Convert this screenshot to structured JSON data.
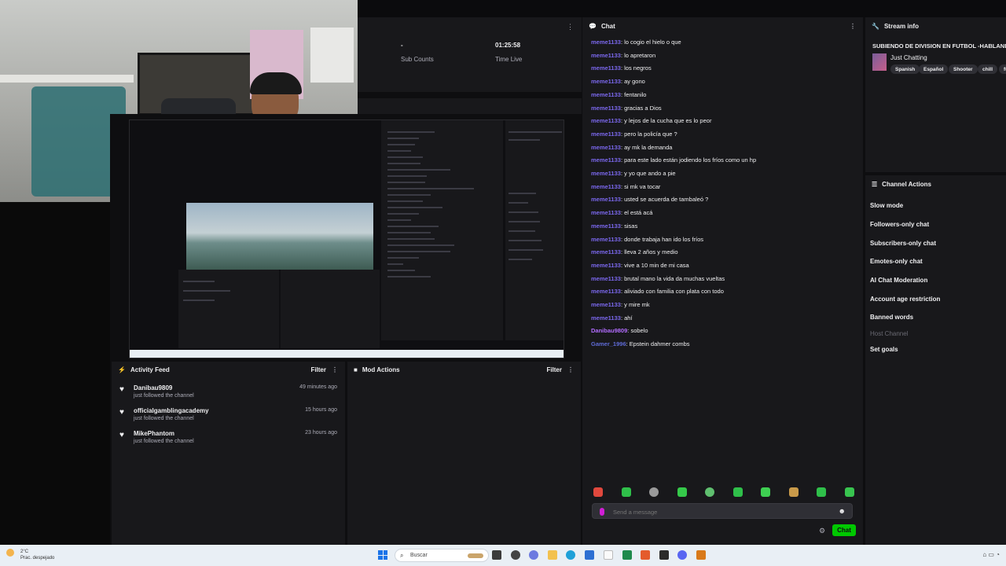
{
  "dashboard": {
    "stats": [
      {
        "value": "-",
        "label": "Sub Counts"
      },
      {
        "value": "01:25:58",
        "label": "Time Live"
      }
    ]
  },
  "activity_feed": {
    "title": "Activity Feed",
    "filter_label": "Filter",
    "items": [
      {
        "name": "Danibau9809",
        "action": "just followed the channel",
        "time": "49 minutes ago"
      },
      {
        "name": "officialgamblingacademy",
        "action": "just followed the channel",
        "time": "15 hours ago"
      },
      {
        "name": "MikePhantom",
        "action": "just followed the channel",
        "time": "23 hours ago"
      }
    ]
  },
  "mod_actions": {
    "title": "Mod Actions",
    "filter_label": "Filter"
  },
  "chat": {
    "title": "Chat",
    "messages": [
      {
        "user": "meme1133",
        "text": "lo cogio el hielo o que",
        "color": "#7b68ee"
      },
      {
        "user": "meme1133",
        "text": "lo apretaron",
        "color": "#7b68ee"
      },
      {
        "user": "meme1133",
        "text": "los negros",
        "color": "#7b68ee"
      },
      {
        "user": "meme1133",
        "text": "ay gono",
        "color": "#7b68ee"
      },
      {
        "user": "meme1133",
        "text": "fentanilo",
        "color": "#7b68ee"
      },
      {
        "user": "meme1133",
        "text": "gracias a Dios",
        "color": "#7b68ee"
      },
      {
        "user": "meme1133",
        "text": "y lejos de la cucha que es lo peor",
        "color": "#7b68ee"
      },
      {
        "user": "meme1133",
        "text": "pero la policía que ?",
        "color": "#7b68ee"
      },
      {
        "user": "meme1133",
        "text": "ay mk la demanda",
        "color": "#7b68ee"
      },
      {
        "user": "meme1133",
        "text": "para este lado están jodiendo los fríos como un hp",
        "color": "#7b68ee"
      },
      {
        "user": "meme1133",
        "text": "y yo que ando a pie",
        "color": "#7b68ee"
      },
      {
        "user": "meme1133",
        "text": "si mk va tocar",
        "color": "#7b68ee"
      },
      {
        "user": "meme1133",
        "text": "usted se acuerda de tambaleó ?",
        "color": "#7b68ee"
      },
      {
        "user": "meme1133",
        "text": "el está acá",
        "color": "#7b68ee"
      },
      {
        "user": "meme1133",
        "text": "sisas",
        "color": "#7b68ee"
      },
      {
        "user": "meme1133",
        "text": "donde trabaja han ido los fríos",
        "color": "#7b68ee"
      },
      {
        "user": "meme1133",
        "text": "lleva 2 años y medio",
        "color": "#7b68ee"
      },
      {
        "user": "meme1133",
        "text": "vive a 10 min de mi casa",
        "color": "#7b68ee"
      },
      {
        "user": "meme1133",
        "text": "brutal mano la vida da muchas vueltas",
        "color": "#7b68ee"
      },
      {
        "user": "meme1133",
        "text": "aliviado con familia con plata con todo",
        "color": "#7b68ee"
      },
      {
        "user": "meme1133",
        "text": "y mire mk",
        "color": "#7b68ee"
      },
      {
        "user": "meme1133",
        "text": "ahí",
        "color": "#7b68ee"
      },
      {
        "user": "Danibau9809",
        "text": "sobelo",
        "color": "#b26cff"
      },
      {
        "user": "Gamer_1996",
        "text": "Epstein dahmer combs",
        "color": "#5f6bd6"
      }
    ],
    "input_placeholder": "Send a message",
    "send_label": "Chat"
  },
  "stream_info": {
    "title": "Stream info",
    "stream_title": "SUBIENDO DE DIVISION EN FUTBOL -HABLANDO",
    "category": "Just Chatting",
    "tags": [
      "Spanish",
      "Español",
      "Shooter",
      "chill",
      "fu"
    ]
  },
  "channel_actions": {
    "title": "Channel Actions",
    "items": [
      {
        "label": "Slow mode",
        "enabled": true
      },
      {
        "label": "Followers-only chat",
        "enabled": true
      },
      {
        "label": "Subscribers-only chat",
        "enabled": true
      },
      {
        "label": "Emotes-only chat",
        "enabled": true
      },
      {
        "label": "AI Chat Moderation",
        "enabled": true
      },
      {
        "label": "Account age restriction",
        "enabled": true
      },
      {
        "label": "Banned words",
        "enabled": true
      },
      {
        "label": "Host Channel",
        "enabled": false
      },
      {
        "label": "Set goals",
        "enabled": true
      }
    ]
  },
  "taskbar": {
    "weather_temp": "2°C",
    "weather_desc": "Prac. despejado",
    "search_label": "Buscar"
  },
  "colors": {
    "accent_green": "#00c800",
    "bg": "#0e0e10",
    "panel": "#18181b"
  }
}
